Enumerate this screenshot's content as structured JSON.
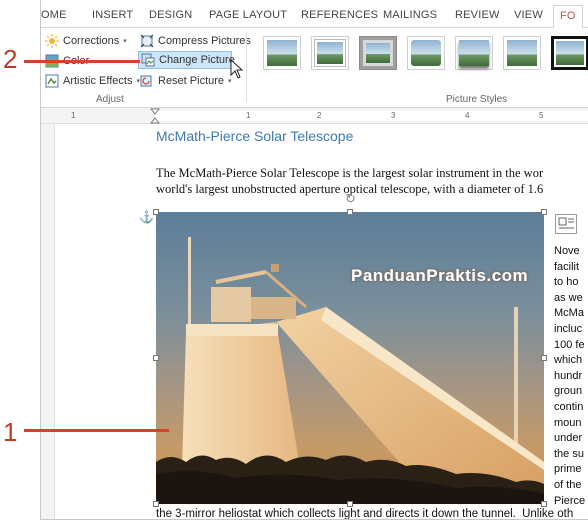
{
  "ribbon": {
    "tabs": [
      "OME",
      "INSERT",
      "DESIGN",
      "PAGE LAYOUT",
      "REFERENCES",
      "MAILINGS",
      "REVIEW",
      "VIEW",
      "FO"
    ],
    "active_tab": "FO",
    "adjust": {
      "corrections": "Corrections",
      "color": "Color",
      "artistic_effects": "Artistic Effects",
      "compress": "Compress Pictures",
      "change_picture": "Change Picture",
      "reset_picture": "Reset Picture",
      "group_label": "Adjust"
    },
    "picture_styles": {
      "group_label": "Picture Styles",
      "count": 7
    }
  },
  "ruler": {
    "numbers": [
      "1",
      "1",
      "2",
      "3",
      "4",
      "5"
    ]
  },
  "document": {
    "heading": "McMath-Pierce Solar Telescope",
    "para_line1": "The McMath-Pierce Solar Telescope is the largest solar instrument in the wor",
    "para_line2": "world's largest unobstructed aperture optical telescope, with a diameter of 1.6",
    "side_lines": [
      "Nove",
      "facilit",
      "to ho",
      "as we",
      "McMa",
      "incluc",
      "100 fe",
      "which",
      "hundr",
      "groun",
      "contin",
      "moun",
      "under",
      "the su",
      "prime",
      "of the",
      "Pierce",
      "Unlike oth"
    ],
    "caption": "the 3-mirror heliostat which collects light and directs it down the tunnel."
  },
  "watermark": "PanduanPraktis.com",
  "callouts": {
    "one": "1",
    "two": "2"
  },
  "colors": {
    "accent": "#c0504d",
    "callout": "#d9412b",
    "heading": "#3e7ab8"
  }
}
